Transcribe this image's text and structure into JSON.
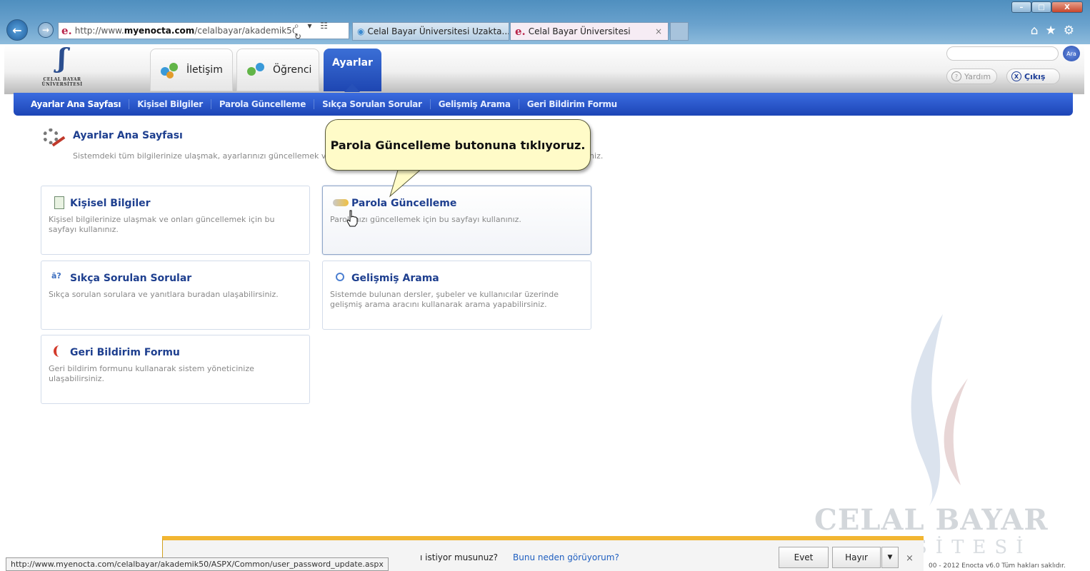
{
  "browser": {
    "address_url": "http://www.myenocta.com/celalbayar/akademik50",
    "address_url_prefix": "http://www.",
    "address_url_host": "myenocta.com",
    "address_url_path": "/celalbayar/akademik5C",
    "address_icons": "⌕ ▾ ☷ ↻",
    "tabs": [
      {
        "label": "Celal Bayar Üniversitesi Uzakta..."
      },
      {
        "label": "Celal Bayar Üniversitesi"
      }
    ],
    "tab_close_symbol": "×",
    "toolbar_icons": "⌂★⚙",
    "window_buttons": [
      "–",
      "□",
      "X"
    ],
    "back_symbol": "←",
    "forward_symbol": "→",
    "ie_logo": "e."
  },
  "app": {
    "logo_text": "CELAL BAYAR ÜNİVERSİTESİ",
    "tabs": {
      "iletisim": "İletişim",
      "ogrenci": "Öğrenci",
      "ayarlar": "Ayarlar"
    },
    "search_button": "Ara",
    "help_label": "Yardım",
    "exit_label": "Çıkış",
    "help_icon": "?",
    "exit_icon": "X"
  },
  "subnav": [
    "Ayarlar Ana Sayfası",
    "Kişisel Bilgiler",
    "Parola Güncelleme",
    "Sıkça Sorulan Sorular",
    "Gelişmiş Arama",
    "Geri Bildirim Formu"
  ],
  "page": {
    "title": "Ayarlar Ana Sayfası",
    "description": "Sistemdeki tüm bilgilerinize ulaşmak, ayarlarınızı güncellemek ve",
    "description_end": "iniz."
  },
  "cards": {
    "kisisel": {
      "title": "Kişisel Bilgiler",
      "desc": "Kişisel bilgilerinize ulaşmak ve onları güncellemek için bu sayfayı kullanınız."
    },
    "parola": {
      "title": "Parola Güncelleme",
      "desc": "Parolanızı güncellemek için bu sayfayı kullanınız."
    },
    "sss": {
      "title": "Sıkça Sorulan Sorular",
      "desc": "Sıkça sorulan sorulara ve yanıtlara buradan ulaşabilirsiniz.",
      "icon_text": "ā?"
    },
    "arama": {
      "title": "Gelişmiş Arama",
      "desc": "Sistemde bulunan dersler, şubeler ve kullanıcılar üzerinde gelişmiş arama aracını kullanarak arama yapabilirsiniz."
    },
    "geri": {
      "title": "Geri Bildirim Formu",
      "desc": "Geri bildirim formunu kullanarak sistem yöneticinize ulaşabilirsiniz."
    }
  },
  "callout": {
    "text": "Parola Güncelleme butonuna tıklıyoruz."
  },
  "watermark": {
    "line1": "CELAL BAYAR",
    "line2": "SİTESİ"
  },
  "notification": {
    "question": "ı istiyor musunuz?",
    "why_link": "Bunu neden görüyorum?",
    "yes": "Evet",
    "no": "Hayır",
    "dropdown_symbol": "▼",
    "close_symbol": "×"
  },
  "status": {
    "url": "http://www.myenocta.com/celalbayar/akademik50/ASPX/Common/user_password_update.aspx"
  },
  "footer": {
    "text": "00 - 2012 Enocta v6.0 Tüm hakları saklıdır."
  },
  "colors": {
    "accent_blue": "#1e46b2",
    "link_blue": "#1e3f8f",
    "callout_bg": "#fffbc8",
    "notification_bar": "#f2b632"
  }
}
